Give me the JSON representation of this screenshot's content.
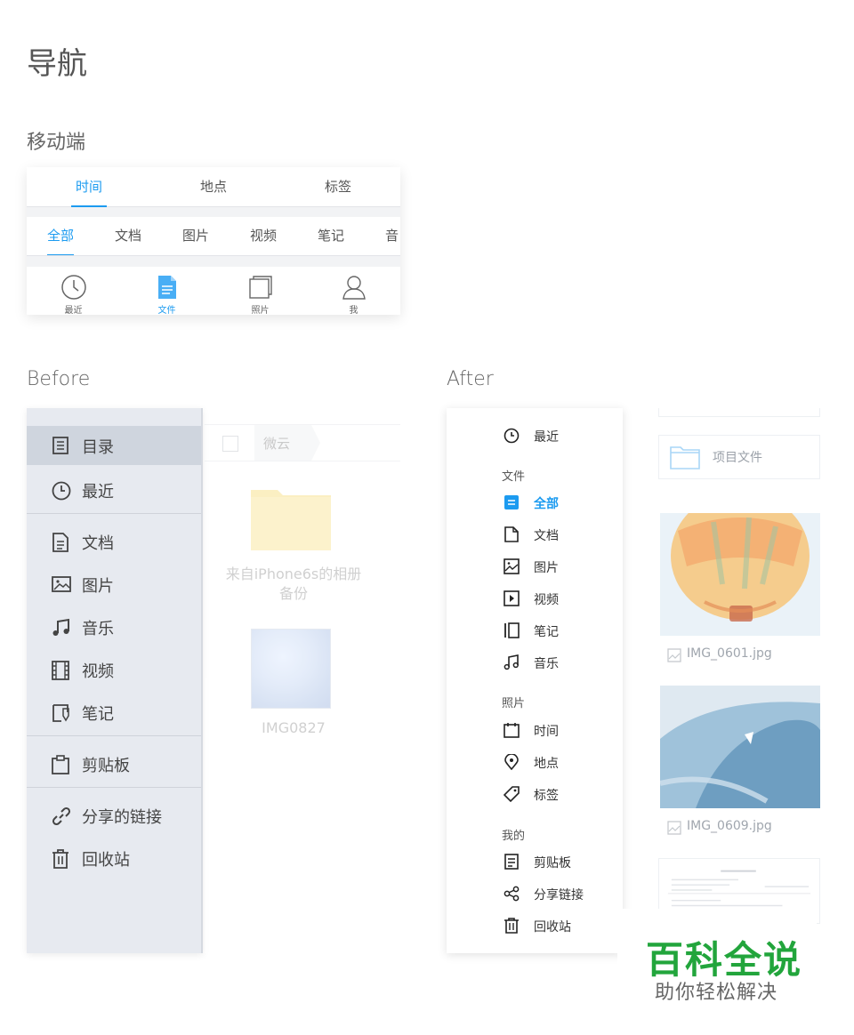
{
  "page": {
    "title": "导航",
    "mobile_heading": "移动端",
    "before_heading": "Before",
    "after_heading": "After"
  },
  "colors": {
    "accent": "#1c9bf0",
    "watermark_green": "#22a53c"
  },
  "mobile": {
    "top_tabs": [
      {
        "label": "时间",
        "active": true
      },
      {
        "label": "地点",
        "active": false
      },
      {
        "label": "标签",
        "active": false
      }
    ],
    "categories": [
      {
        "label": "全部",
        "active": true
      },
      {
        "label": "文档",
        "active": false
      },
      {
        "label": "图片",
        "active": false
      },
      {
        "label": "视频",
        "active": false
      },
      {
        "label": "笔记",
        "active": false
      },
      {
        "label": "音",
        "active": false
      }
    ],
    "bottom_bar": [
      {
        "label": "最近",
        "icon": "clock-icon"
      },
      {
        "label": "文件",
        "icon": "document-icon",
        "active": true
      },
      {
        "label": "照片",
        "icon": "photos-icon"
      },
      {
        "label": "我",
        "icon": "person-icon"
      }
    ]
  },
  "before": {
    "sidebar": [
      {
        "label": "目录",
        "icon": "list-icon",
        "selected": true
      },
      {
        "label": "最近",
        "icon": "clock-icon"
      },
      {
        "label": "文档",
        "icon": "document-icon"
      },
      {
        "label": "图片",
        "icon": "image-icon"
      },
      {
        "label": "音乐",
        "icon": "music-icon"
      },
      {
        "label": "视频",
        "icon": "film-icon"
      },
      {
        "label": "笔记",
        "icon": "note-icon"
      },
      {
        "label": "剪贴板",
        "icon": "clipboard-icon"
      },
      {
        "label": "分享的链接",
        "icon": "link-icon"
      },
      {
        "label": "回收站",
        "icon": "trash-icon"
      }
    ],
    "breadcrumb": "微云",
    "folder_name": "来自iPhone6s的相册备份",
    "photo_name": "IMG0827"
  },
  "after": {
    "sidebar": {
      "recent": {
        "label": "最近",
        "icon": "clock-icon"
      },
      "files_heading": "文件",
      "files": [
        {
          "label": "全部",
          "icon": "all-files-icon",
          "active": true
        },
        {
          "label": "文档",
          "icon": "document-icon"
        },
        {
          "label": "图片",
          "icon": "image-icon"
        },
        {
          "label": "视频",
          "icon": "video-icon"
        },
        {
          "label": "笔记",
          "icon": "note-icon"
        },
        {
          "label": "音乐",
          "icon": "music-icon"
        }
      ],
      "photos_heading": "照片",
      "photos": [
        {
          "label": "时间",
          "icon": "calendar-icon"
        },
        {
          "label": "地点",
          "icon": "location-icon"
        },
        {
          "label": "标签",
          "icon": "tag-icon"
        }
      ],
      "mine_heading": "我的",
      "mine": [
        {
          "label": "剪贴板",
          "icon": "clipboard-icon"
        },
        {
          "label": "分享链接",
          "icon": "share-icon"
        },
        {
          "label": "回收站",
          "icon": "trash-icon"
        }
      ]
    },
    "files": {
      "folder_name": "项目文件",
      "photo1_name": "IMG_0601.jpg",
      "photo2_name": "IMG_0609.jpg"
    }
  },
  "watermark": {
    "line1": "百科全说",
    "line2": "助你轻松解决"
  }
}
